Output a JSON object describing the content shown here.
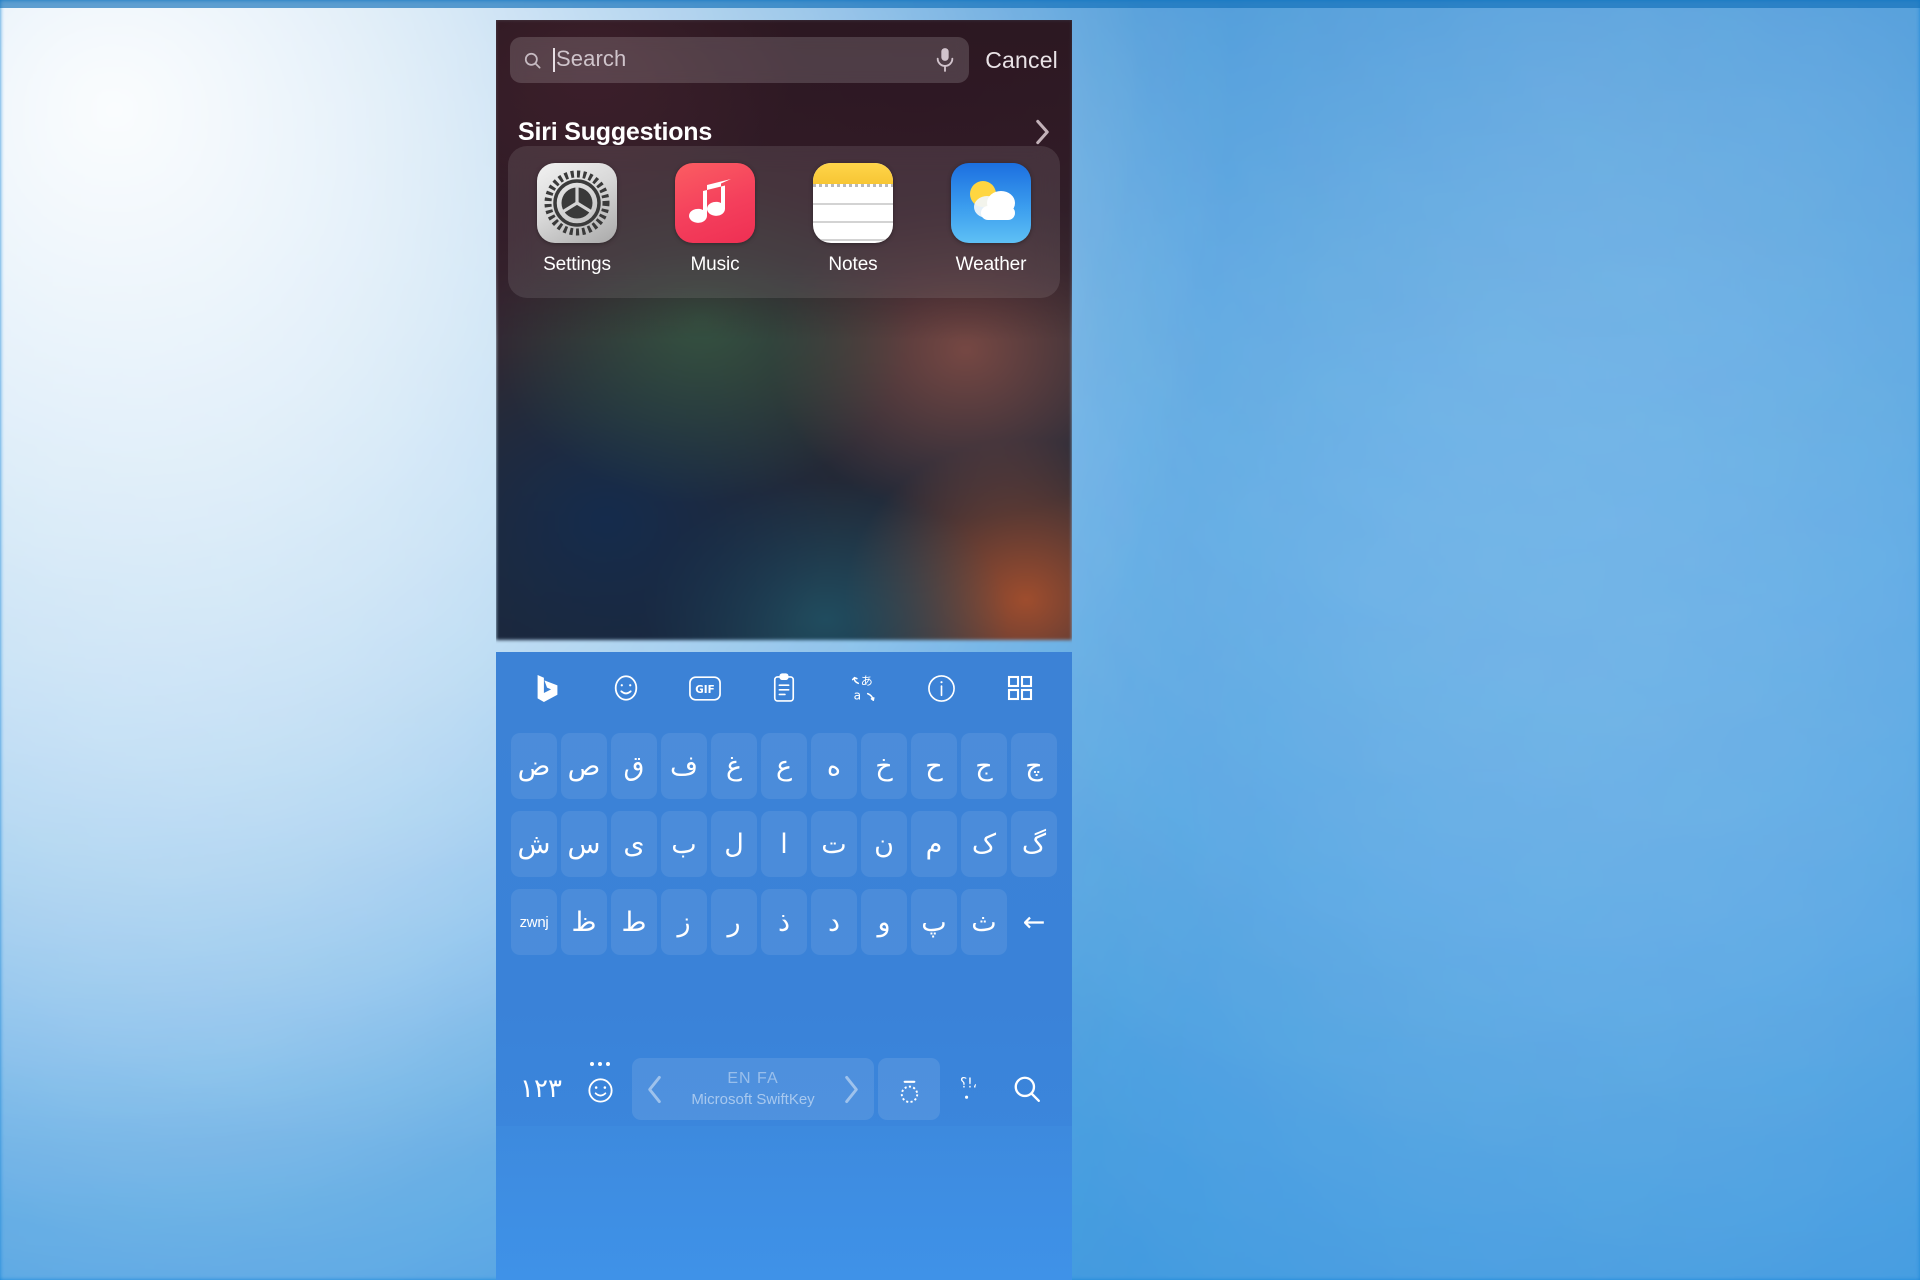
{
  "wallpaper": {
    "color": "#1d88da",
    "description": "blurred-blue-blobs"
  },
  "ios": {
    "search": {
      "placeholder": "Search",
      "value": "",
      "search_icon": "search-icon",
      "mic_icon": "microphone-icon",
      "cancel_label": "Cancel"
    },
    "siri": {
      "title": "Siri Suggestions",
      "chevron_icon": "chevron-right-icon",
      "apps": [
        {
          "label": "Settings",
          "icon": "settings-gear-icon"
        },
        {
          "label": "Music",
          "icon": "music-note-icon"
        },
        {
          "label": "Notes",
          "icon": "notes-paper-icon"
        },
        {
          "label": "Weather",
          "icon": "weather-sun-cloud-icon"
        }
      ]
    }
  },
  "keyboard": {
    "brand": "Microsoft SwiftKey",
    "accent_color": "#3c82d6",
    "toolbar": [
      {
        "name": "bing-icon",
        "label": ""
      },
      {
        "name": "emoji-icon",
        "label": ""
      },
      {
        "name": "gif-icon",
        "label": "GIF"
      },
      {
        "name": "clipboard-icon",
        "label": ""
      },
      {
        "name": "translate-icon",
        "label": ""
      },
      {
        "name": "info-icon",
        "label": ""
      },
      {
        "name": "grid-menu-icon",
        "label": ""
      }
    ],
    "rows": [
      {
        "keys": [
          "ض",
          "ص",
          "ق",
          "ف",
          "غ",
          "ع",
          "ه",
          "خ",
          "ح",
          "ج",
          "چ"
        ]
      },
      {
        "keys": [
          "ش",
          "س",
          "ی",
          "ب",
          "ل",
          "ا",
          "ت",
          "ن",
          "م",
          "ک",
          "گ"
        ]
      },
      {
        "keys": [
          "zwnj",
          "ظ",
          "ط",
          "ز",
          "ر",
          "ذ",
          "د",
          "و",
          "پ",
          "ث",
          "←"
        ]
      }
    ],
    "bottom": {
      "numbers_label": "۱۲۳",
      "emoji_icon": "emoji-smiley-icon",
      "prev_icon": "chevron-left-icon",
      "next_icon": "chevron-right-icon",
      "space_language": "EN FA",
      "space_brand": "Microsoft SwiftKey",
      "diacritic_label": "◌َ",
      "punct_label": "؟!،",
      "search_icon": "search-icon"
    }
  }
}
